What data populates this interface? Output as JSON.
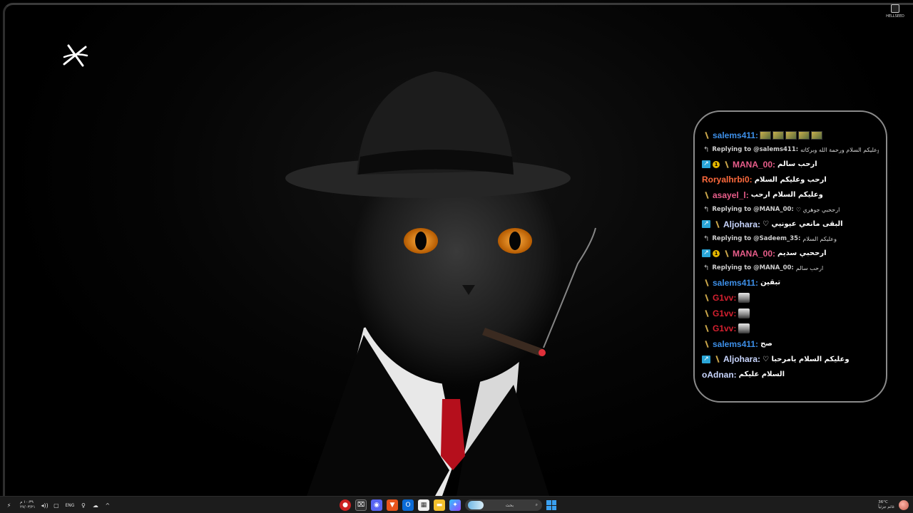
{
  "desktop": {
    "top_right_icon_label": "HELLSEED"
  },
  "colors": {
    "name_blue": "#3d8fe8",
    "name_pink": "#e85d8a",
    "name_red": "#d4202f",
    "name_light": "#c9d6ff",
    "name_orange": "#ff6a3d"
  },
  "chat": {
    "messages": [
      {
        "type": "msg",
        "badges": [
          "sword"
        ],
        "name": "salems411:",
        "color": "name_blue",
        "text": "",
        "emotes": 5
      },
      {
        "type": "reply",
        "reply_text": "Replying to @salems411:",
        "text": "وعليكم السلام ورحمة الله وبركاته"
      },
      {
        "type": "msg",
        "badges": [
          "arrow",
          "coin",
          "sword"
        ],
        "name": "MANA_00:",
        "color": "name_pink",
        "text": "ارحب سالم"
      },
      {
        "type": "msg",
        "badges": [],
        "name": "Roryalhrbi0:",
        "color": "name_orange",
        "text": "ارحب وعليكم السلام"
      },
      {
        "type": "msg",
        "badges": [
          "sword"
        ],
        "name": "asayel_l:",
        "color": "name_pink",
        "text": "وعليكم السلام ارحب"
      },
      {
        "type": "reply",
        "reply_text": "Replying to @MANA_00:",
        "text": "ارححبي جوهري ♡"
      },
      {
        "type": "msg",
        "badges": [
          "arrow",
          "sword"
        ],
        "name": "Aljohara:",
        "color": "name_light",
        "text": "البقى مانعي عيونيي ♡"
      },
      {
        "type": "reply",
        "reply_text": "Replying to @Sadeem_35:",
        "text": "وعليكم السلام"
      },
      {
        "type": "msg",
        "badges": [
          "arrow",
          "coin",
          "sword"
        ],
        "name": "MANA_00:",
        "color": "name_pink",
        "text": "ارححبي سديم"
      },
      {
        "type": "reply",
        "reply_text": "Replying to @MANA_00:",
        "text": "ارحب سالم"
      },
      {
        "type": "msg",
        "badges": [
          "sword"
        ],
        "name": "salems411:",
        "color": "name_blue",
        "text": "تبقين"
      },
      {
        "type": "msg",
        "badges": [
          "sword"
        ],
        "name": "G1vv:",
        "color": "name_red",
        "text": "",
        "gemote": true
      },
      {
        "type": "msg",
        "badges": [
          "sword"
        ],
        "name": "G1vv:",
        "color": "name_red",
        "text": "",
        "gemote": true
      },
      {
        "type": "msg",
        "badges": [
          "sword"
        ],
        "name": "G1vv:",
        "color": "name_red",
        "text": "",
        "gemote": true
      },
      {
        "type": "msg",
        "badges": [
          "sword"
        ],
        "name": "salems411:",
        "color": "name_blue",
        "text": "صح"
      },
      {
        "type": "msg",
        "badges": [
          "arrow",
          "sword"
        ],
        "name": "Aljohara:",
        "color": "name_light",
        "text": "وعليكم السلام يامرحبا ♡"
      },
      {
        "type": "msg",
        "badges": [],
        "name": "oAdnan:",
        "color": "name_light",
        "text": "السلام عليكم"
      }
    ]
  },
  "taskbar": {
    "clock_time": "١٠:٣٩ م",
    "clock_date": "٢٧/٠٣/٢١",
    "lang": "ENG",
    "search_placeholder": "بحث",
    "weather_temp": "36°C",
    "weather_desc": "غائم جزئياً"
  }
}
